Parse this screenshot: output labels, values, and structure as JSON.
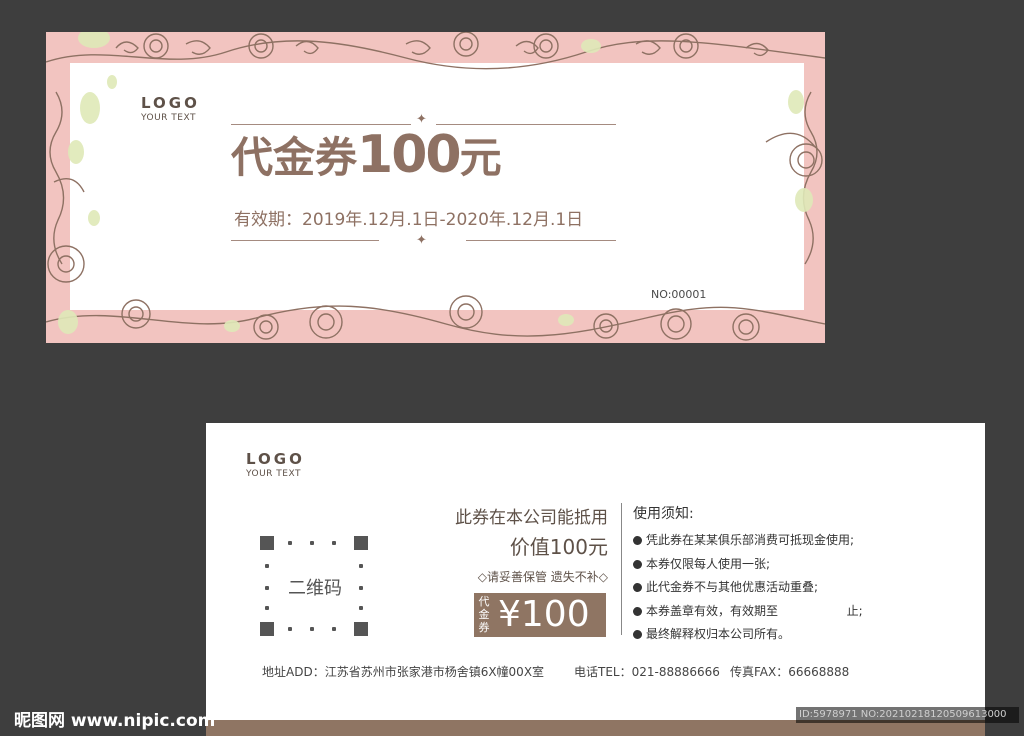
{
  "front": {
    "logo": "LOGO",
    "logo_sub": "YOUR TEXT",
    "title_cn": "代金券",
    "title_amount": "100",
    "title_unit": "元",
    "validity": "有效期：2019年.12月.1日-2020年.12月.1日",
    "serial": "NO:00001"
  },
  "back": {
    "logo": "LOGO",
    "logo_sub": "YOUR TEXT",
    "qr_label": "二维码",
    "offset_line1": "此券在本公司能抵用",
    "offset_line2": "价值100元",
    "keep_note": "◇请妥善保管 遗失不补◇",
    "price_label": "代金券",
    "price_value": "¥100",
    "rules_title": "使用须知:",
    "rules": [
      "凭此券在某某俱乐部消费可抵现金使用;",
      "本券仅限每人使用一张;",
      "此代金券不与其他优惠活动重叠;",
      "本券盖章有效，有效期至                  止;",
      "最终解释权归本公司所有。"
    ],
    "address": "地址ADD：江苏省苏州市张家港市杨舍镇6X幢00X室",
    "phone": "电话TEL：021-88886666",
    "fax": "传真FAX：66668888"
  },
  "watermark": {
    "site": "昵图网 www.nipic.com",
    "id": "ID:5978971 NO:20210218120509613000"
  },
  "colors": {
    "background": "#3e3e3e",
    "frame_pink": "#f2c4c0",
    "brown": "#8e7163",
    "leaf_green": "#dfe9b8"
  }
}
